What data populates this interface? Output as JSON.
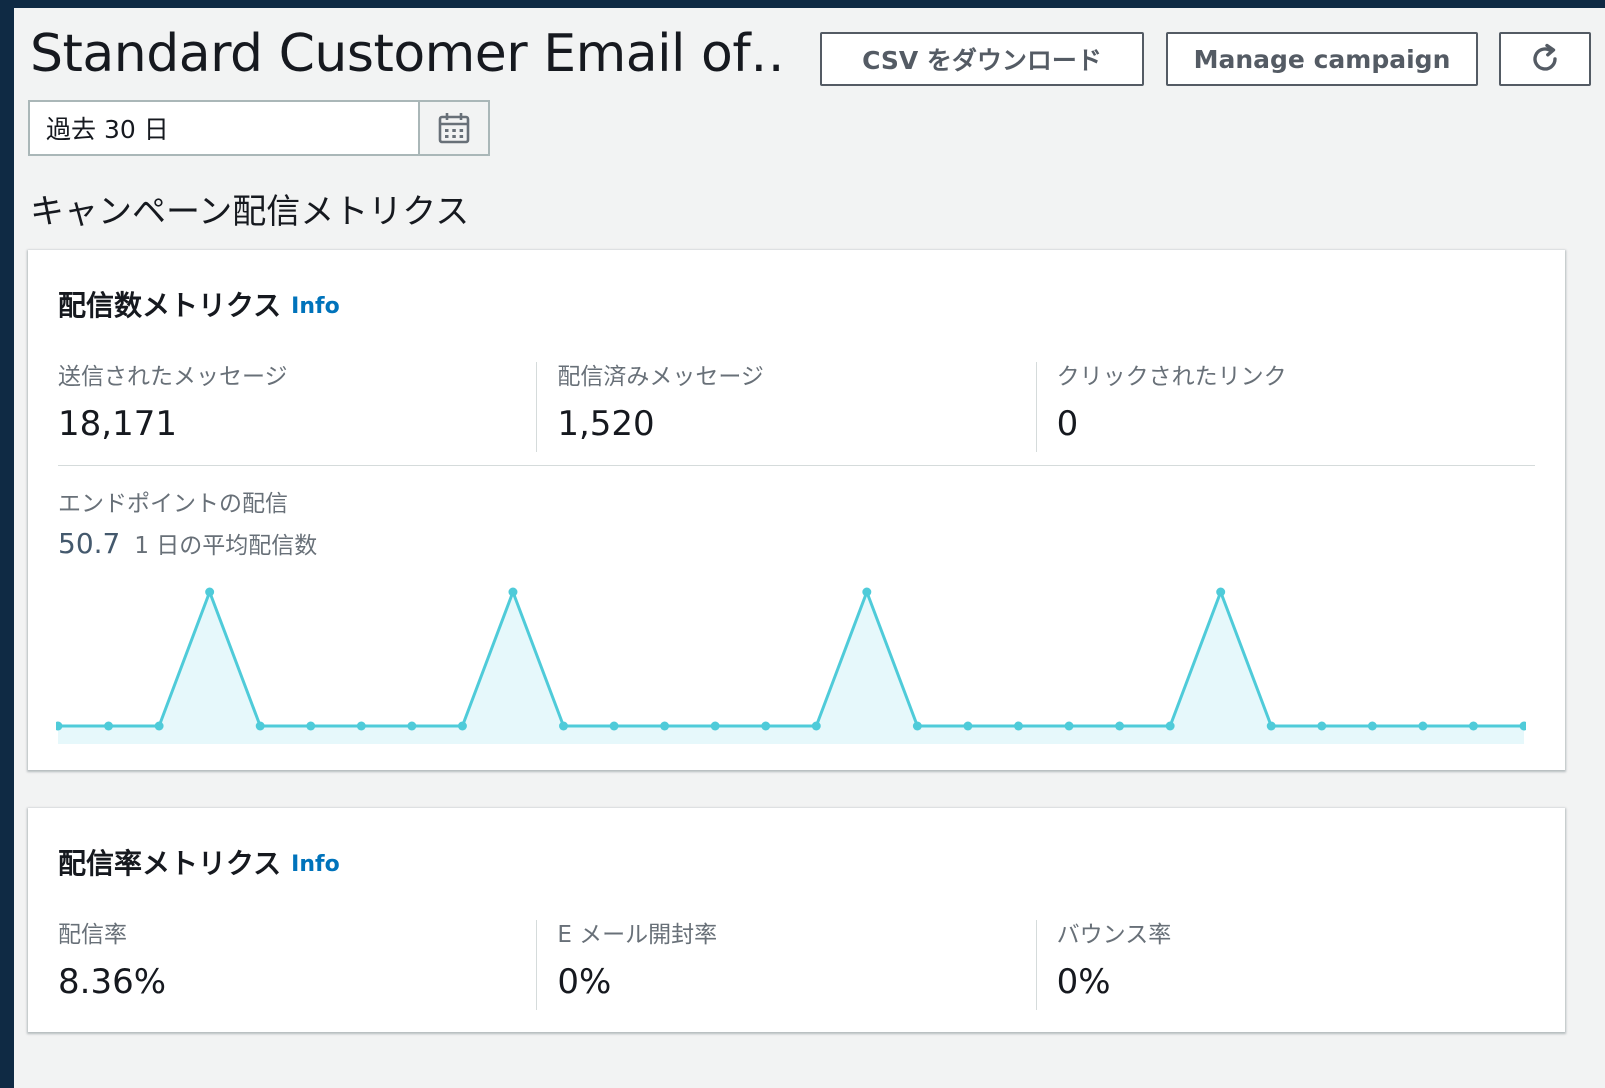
{
  "header": {
    "title": "Standard Customer Email of…",
    "csv_button": "CSV をダウンロード",
    "manage_button": "Manage campaign"
  },
  "date_range": {
    "value": "過去 30 日"
  },
  "section_title": "キャンペーン配信メトリクス",
  "delivery_count_card": {
    "title": "配信数メトリクス",
    "info": "Info",
    "metrics": [
      {
        "label": "送信されたメッセージ",
        "value": "18,171"
      },
      {
        "label": "配信済みメッセージ",
        "value": "1,520"
      },
      {
        "label": "クリックされたリンク",
        "value": "0"
      }
    ],
    "endpoint_label": "エンドポイントの配信",
    "avg_value": "50.7",
    "avg_label": "1 日の平均配信数"
  },
  "delivery_rate_card": {
    "title": "配信率メトリクス",
    "info": "Info",
    "metrics": [
      {
        "label": "配信率",
        "value": "8.36%"
      },
      {
        "label": "E メール開封率",
        "value": "0%"
      },
      {
        "label": "バウンス率",
        "value": "0%"
      }
    ]
  },
  "chart_data": {
    "type": "area",
    "x": [
      1,
      2,
      3,
      4,
      5,
      6,
      7,
      8,
      9,
      10,
      11,
      12,
      13,
      14,
      15,
      16,
      17,
      18,
      19,
      20,
      21,
      22,
      23,
      24,
      25,
      26,
      27,
      28,
      29,
      30
    ],
    "series": [
      {
        "values": [
          0,
          0,
          0,
          380,
          0,
          0,
          0,
          0,
          0,
          380,
          0,
          0,
          0,
          0,
          0,
          0,
          380,
          0,
          0,
          0,
          0,
          0,
          0,
          380,
          0,
          0,
          0,
          0,
          0,
          0
        ]
      }
    ],
    "ylim": [
      0,
      380
    ],
    "grid": false,
    "line_color": "#4fcbd9",
    "fill_color": "#e6f8fb"
  }
}
